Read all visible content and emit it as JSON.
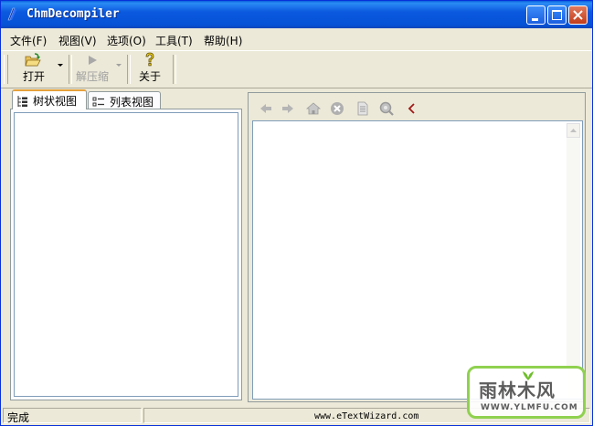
{
  "window": {
    "title": "ChmDecompiler",
    "controls": [
      "minimize",
      "maximize",
      "close"
    ],
    "title_color": "#0a5fdd",
    "close_color": "#c23d1a"
  },
  "menu": [
    {
      "label": "文件(F)"
    },
    {
      "label": "视图(V)"
    },
    {
      "label": "选项(O)"
    },
    {
      "label": "工具(T)"
    },
    {
      "label": "帮助(H)"
    }
  ],
  "toolbar": {
    "open": {
      "label": "打开",
      "icon": "open-folder-icon"
    },
    "decompress": {
      "label": "解压缩",
      "icon": "play-icon",
      "disabled": true
    },
    "about": {
      "label": "关于",
      "icon": "help-question-icon"
    }
  },
  "left_panel": {
    "tabs": [
      {
        "label": "树状视图",
        "icon": "tree-view-icon",
        "active": true
      },
      {
        "label": "列表视图",
        "icon": "list-view-icon",
        "active": false
      }
    ]
  },
  "browser_nav": [
    {
      "name": "back-icon"
    },
    {
      "name": "forward-icon"
    },
    {
      "name": "home-icon"
    },
    {
      "name": "stop-icon"
    },
    {
      "name": "document-icon"
    },
    {
      "name": "search-icon"
    },
    {
      "name": "collapse-icon"
    }
  ],
  "status": {
    "text": "完成",
    "url": "www.eTextWizard.com"
  },
  "watermark": {
    "text": "雨林木风",
    "url": "WWW.YLMFU.COM",
    "color": "#8fd14f"
  }
}
